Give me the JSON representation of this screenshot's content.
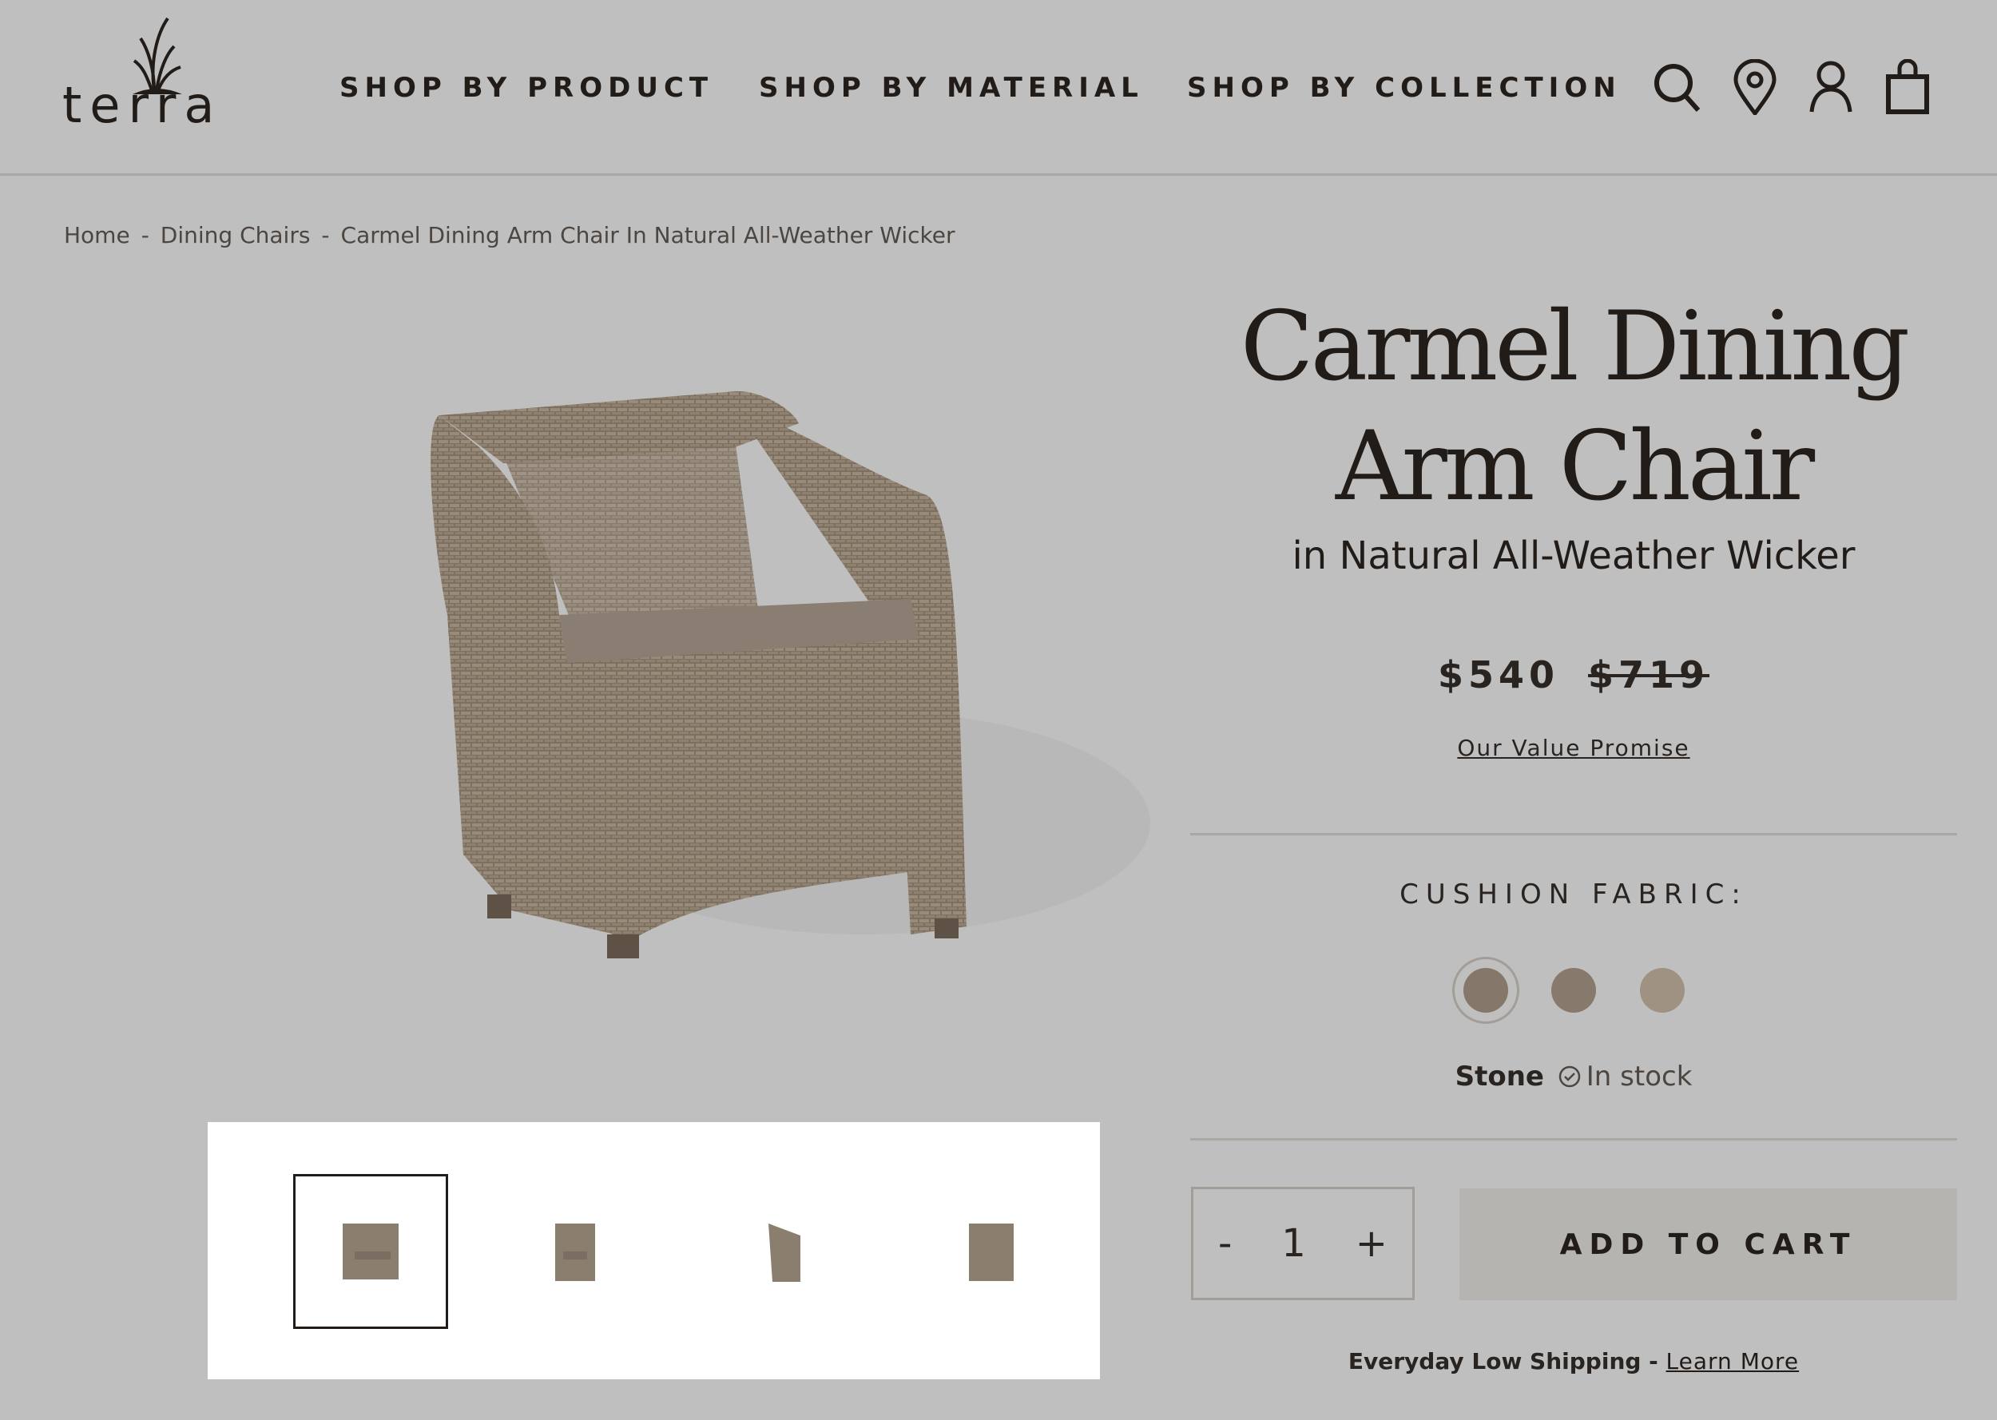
{
  "header": {
    "logo": "terra",
    "nav": [
      "SHOP BY PRODUCT",
      "SHOP BY MATERIAL",
      "SHOP BY COLLECTION"
    ],
    "icons": [
      "search-icon",
      "location-pin-icon",
      "user-icon",
      "shopping-bag-icon"
    ]
  },
  "breadcrumb": [
    "Home",
    "Dining Chairs",
    "Carmel Dining Arm Chair In Natural All-Weather Wicker"
  ],
  "breadcrumb_separator": "-",
  "product": {
    "title_line1": "Carmel Dining",
    "title_line2": "Arm Chair",
    "subtitle": "in Natural All-Weather Wicker",
    "price": "$540",
    "original_price": "$719",
    "value_promise": "Our Value Promise",
    "cushion_label": "CUSHION FABRIC:",
    "swatches": [
      {
        "color": "#857769",
        "selected": true
      },
      {
        "color": "#877a6c"
      },
      {
        "color": "#a09282"
      }
    ],
    "selected_fabric": "Stone",
    "stock": "In stock",
    "qty_minus": "-",
    "quantity": "1",
    "qty_plus": "+",
    "add_to_cart": "ADD TO CART",
    "shipping": "Everyday Low Shipping - ",
    "learn_more": "Learn More"
  },
  "gallery": {
    "thumbnail_count": 4,
    "selected_thumbnail": 1
  }
}
